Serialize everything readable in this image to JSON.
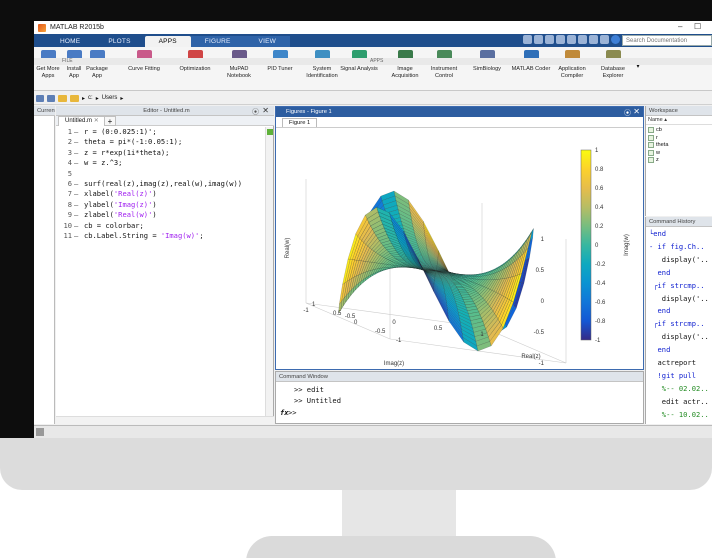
{
  "window": {
    "title": "MATLAB R2015b"
  },
  "tabs": [
    "HOME",
    "PLOTS",
    "APPS",
    "FIGURE",
    "VIEW"
  ],
  "search": {
    "placeholder": "Search Documentation"
  },
  "ribbon": {
    "buttons": [
      {
        "label1": "Get More",
        "label2": "Apps",
        "color": "#4a7bc4"
      },
      {
        "label1": "Install",
        "label2": "App",
        "color": "#4a7bc4"
      },
      {
        "label1": "Package",
        "label2": "App",
        "color": "#4a7bc4"
      },
      {
        "label1": "Curve Fitting",
        "label2": "",
        "color": "#c95a8a"
      },
      {
        "label1": "Optimization",
        "label2": "",
        "color": "#d04545"
      },
      {
        "label1": "MuPAD",
        "label2": "Notebook",
        "color": "#6a5a8a"
      },
      {
        "label1": "PID Tuner",
        "label2": "",
        "color": "#3e86c9"
      },
      {
        "label1": "System",
        "label2": "Identification",
        "color": "#3e8fc2"
      },
      {
        "label1": "Signal Analysis",
        "label2": "",
        "color": "#2e9e6e"
      },
      {
        "label1": "Image",
        "label2": "Acquisition",
        "color": "#3a7a4a"
      },
      {
        "label1": "Instrument",
        "label2": "Control",
        "color": "#4a8a5a"
      },
      {
        "label1": "SimBiology",
        "label2": "",
        "color": "#5a6fa0"
      },
      {
        "label1": "MATLAB Coder",
        "label2": "",
        "color": "#2f6fb8"
      },
      {
        "label1": "Application",
        "label2": "Compiler",
        "color": "#c08a3a"
      },
      {
        "label1": "Database",
        "label2": "Explorer",
        "color": "#8a8a50"
      }
    ],
    "section_file": "FILE",
    "section_apps": "APPS"
  },
  "address": {
    "path": [
      "c:",
      "Users"
    ]
  },
  "current_folder": {
    "title": "Current Folder"
  },
  "editor": {
    "title": "Editor - Untitled.m",
    "tab": "Untitled.m",
    "lines": [
      {
        "n": "1",
        "code": "r = (0:0.025:1)';",
        "str": ""
      },
      {
        "n": "2",
        "code": "theta = pi*(-1:0.05:1);",
        "str": ""
      },
      {
        "n": "3",
        "code": "z = r*exp(1i*theta);",
        "str": ""
      },
      {
        "n": "4",
        "code": "w = z.^3;",
        "str": ""
      },
      {
        "n": "5",
        "code": "",
        "str": ""
      },
      {
        "n": "6",
        "code": "surf(real(z),imag(z),real(w),imag(w))",
        "str": ""
      },
      {
        "n": "7",
        "code": "xlabel(",
        "str": "'Real(z)'",
        "tail": ")"
      },
      {
        "n": "8",
        "code": "ylabel(",
        "str": "'Imag(z)'",
        "tail": ")"
      },
      {
        "n": "9",
        "code": "zlabel(",
        "str": "'Real(w)'",
        "tail": ")"
      },
      {
        "n": "10",
        "code": "cb = colorbar;",
        "str": ""
      },
      {
        "n": "11",
        "code": "cb.Label.String = ",
        "str": "'Imag(w)'",
        "tail": ";"
      }
    ]
  },
  "figure": {
    "window_title": "Figures - Figure 1",
    "tab": "Figure 1",
    "xlabel": "Imag(z)",
    "ylabel": "Real(z)",
    "zlabel": "Real(w)",
    "cblabel": "Imag(w)",
    "x_ticks": [
      "1",
      "0.5",
      "0",
      "-0.5",
      "-1"
    ],
    "y_ticks": [
      "1",
      "0.5",
      "0",
      "-0.5",
      "-1"
    ],
    "z_ticks": [
      "1",
      "0.5",
      "0",
      "-0.5",
      "-1"
    ],
    "cb_ticks": [
      "1",
      "0.8",
      "0.6",
      "0.4",
      "0.2",
      "0",
      "-0.2",
      "-0.4",
      "-0.6",
      "-0.8",
      "-1"
    ]
  },
  "command_window": {
    "title": "Command Window",
    "lines": [
      ">> edit",
      ">> Untitled"
    ],
    "prompt": ">>",
    "fx": "fx"
  },
  "workspace": {
    "title": "Workspace",
    "col": "Name",
    "vars": [
      "cb",
      "r",
      "theta",
      "w",
      "z"
    ]
  },
  "history": {
    "title": "Command History",
    "lines": [
      {
        "t": "└end",
        "c": "kw"
      },
      {
        "t": "- if fig.Ch..",
        "c": "kw"
      },
      {
        "t": "   display('..",
        "c": ""
      },
      {
        "t": "  end",
        "c": "kw"
      },
      {
        "t": " ┌if strcmp..",
        "c": "kw"
      },
      {
        "t": "   display('..",
        "c": ""
      },
      {
        "t": "  end",
        "c": "kw"
      },
      {
        "t": " ┌if strcmp..",
        "c": "kw"
      },
      {
        "t": "   display('..",
        "c": ""
      },
      {
        "t": "  end",
        "c": "kw"
      },
      {
        "t": "  actreport",
        "c": ""
      },
      {
        "t": "  !git pull",
        "c": "kw"
      },
      {
        "t": "   %-- 02.02..",
        "c": "cm"
      },
      {
        "t": "   edit actr..",
        "c": ""
      },
      {
        "t": "   %-- 10.02..",
        "c": "cm"
      }
    ]
  },
  "colors": {
    "tabstrip": "#1f4e8c",
    "figure_header": "#2d5da0"
  }
}
